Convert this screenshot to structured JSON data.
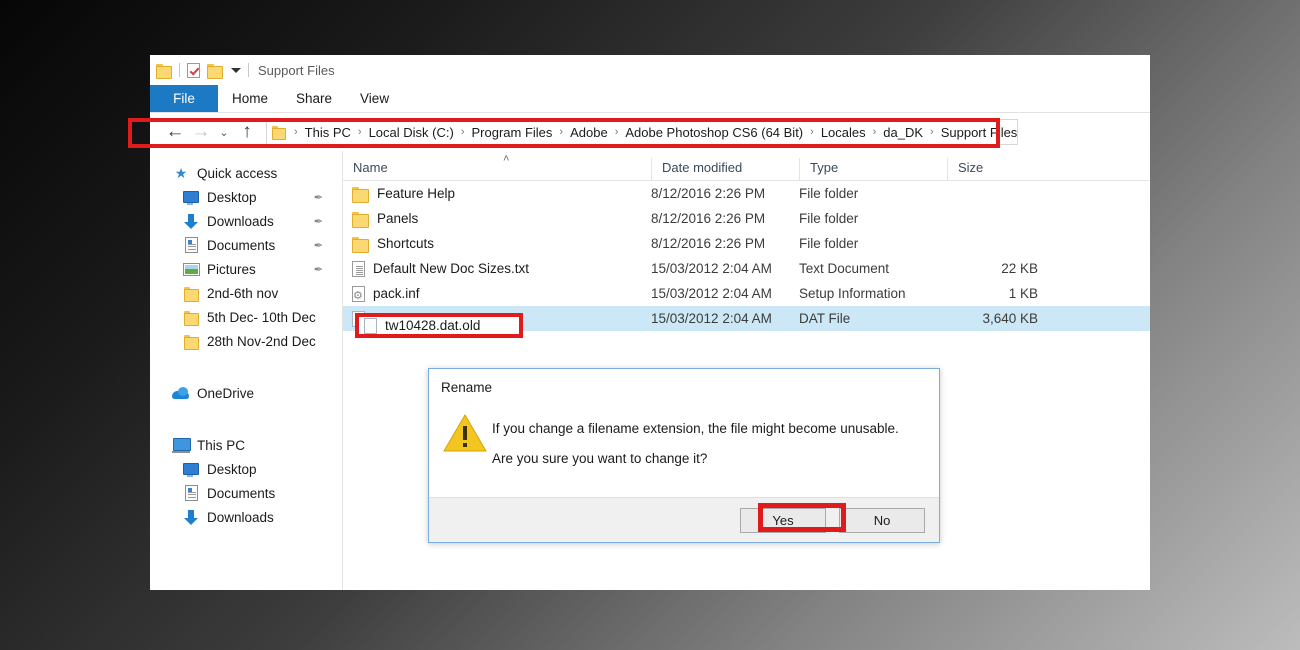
{
  "window": {
    "title": "Support Files",
    "quick_access": [
      "folder-icon",
      "properties-icon",
      "new-folder-icon",
      "dropdown-caret-icon"
    ]
  },
  "ribbon": {
    "tabs": [
      {
        "label": "File",
        "active": true
      },
      {
        "label": "Home",
        "active": false
      },
      {
        "label": "Share",
        "active": false
      },
      {
        "label": "View",
        "active": false
      }
    ],
    "file_tab_color": "#1c7ac4"
  },
  "address_bar": {
    "back_label": "←",
    "forward_label": "→",
    "history_label": "⌄",
    "up_label": "↑",
    "crumbs": [
      "This PC",
      "Local Disk (C:)",
      "Program Files",
      "Adobe",
      "Adobe Photoshop CS6 (64 Bit)",
      "Locales",
      "da_DK",
      "Support Files"
    ],
    "separator": "›",
    "highlight_color": "#e01b1b"
  },
  "sidebar": {
    "groups": [
      {
        "header": {
          "label": "Quick access",
          "icon": "star-icon"
        },
        "items": [
          {
            "label": "Desktop",
            "icon": "desktop-icon",
            "pinned": true
          },
          {
            "label": "Downloads",
            "icon": "download-icon",
            "pinned": true
          },
          {
            "label": "Documents",
            "icon": "documents-icon",
            "pinned": true
          },
          {
            "label": "Pictures",
            "icon": "pictures-icon",
            "pinned": true
          },
          {
            "label": "2nd-6th nov",
            "icon": "folder-icon",
            "pinned": false
          },
          {
            "label": "5th Dec- 10th Dec",
            "icon": "folder-icon",
            "pinned": false
          },
          {
            "label": "28th Nov-2nd Dec",
            "icon": "folder-icon",
            "pinned": false
          }
        ]
      },
      {
        "header": {
          "label": "OneDrive",
          "icon": "cloud-icon"
        },
        "items": []
      },
      {
        "header": {
          "label": "This PC",
          "icon": "pc-icon"
        },
        "items": [
          {
            "label": "Desktop",
            "icon": "desktop-icon",
            "pinned": false
          },
          {
            "label": "Documents",
            "icon": "documents-icon",
            "pinned": false
          },
          {
            "label": "Downloads",
            "icon": "download-icon",
            "pinned": false
          }
        ]
      }
    ],
    "pin_glyph": "✒"
  },
  "file_list": {
    "sort_indicator": "˄",
    "columns": [
      "Name",
      "Date modified",
      "Type",
      "Size"
    ],
    "rows": [
      {
        "name": "Feature Help",
        "date": "8/12/2016 2:26 PM",
        "type": "File folder",
        "size": "",
        "icon": "folder-icon",
        "selected": false
      },
      {
        "name": "Panels",
        "date": "8/12/2016 2:26 PM",
        "type": "File folder",
        "size": "",
        "icon": "folder-icon",
        "selected": false
      },
      {
        "name": "Shortcuts",
        "date": "8/12/2016 2:26 PM",
        "type": "File folder",
        "size": "",
        "icon": "folder-icon",
        "selected": false
      },
      {
        "name": "Default New Doc Sizes.txt",
        "date": "15/03/2012 2:04 AM",
        "type": "Text Document",
        "size": "22 KB",
        "icon": "text-document-icon",
        "selected": false
      },
      {
        "name": "pack.inf",
        "date": "15/03/2012 2:04 AM",
        "type": "Setup Information",
        "size": "1 KB",
        "icon": "setup-information-icon",
        "selected": false
      },
      {
        "name": "tw10428.dat.old",
        "date": "15/03/2012 2:04 AM",
        "type": "DAT File",
        "size": "3,640 KB",
        "icon": "dat-file-icon",
        "selected": true
      }
    ],
    "selected_name": "tw10428.dat.old",
    "selection_color": "#cce8f6",
    "highlight_color": "#e01b1b"
  },
  "dialog": {
    "title": "Rename",
    "icon": "warning-icon",
    "message_line1": "If you change a filename extension, the file might become unusable.",
    "message_line2": "Are you sure you want to change it?",
    "buttons": [
      {
        "label": "Yes",
        "highlighted": true
      },
      {
        "label": "No",
        "highlighted": false
      }
    ],
    "highlight_color": "#e01b1b"
  }
}
